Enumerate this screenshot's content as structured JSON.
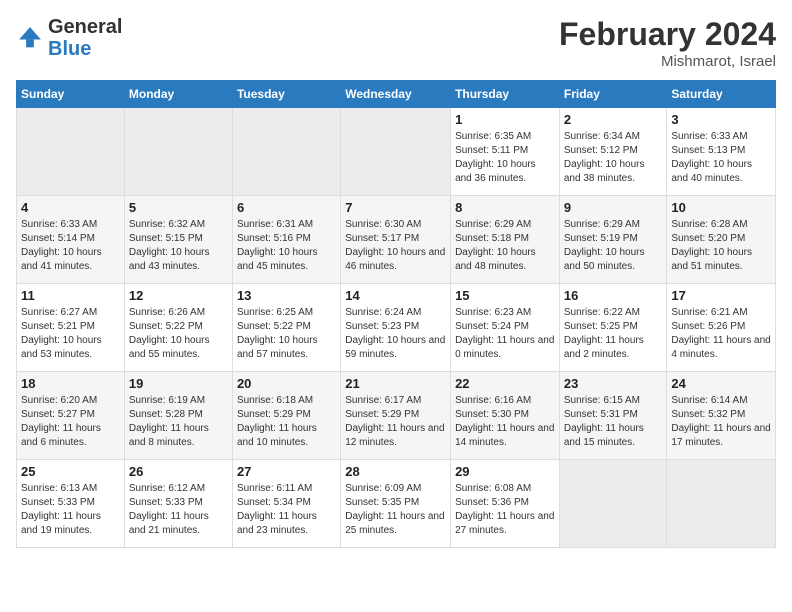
{
  "header": {
    "logo_general": "General",
    "logo_blue": "Blue",
    "month_title": "February 2024",
    "location": "Mishmarot, Israel"
  },
  "days_of_week": [
    "Sunday",
    "Monday",
    "Tuesday",
    "Wednesday",
    "Thursday",
    "Friday",
    "Saturday"
  ],
  "weeks": [
    [
      {
        "day": "",
        "empty": true
      },
      {
        "day": "",
        "empty": true
      },
      {
        "day": "",
        "empty": true
      },
      {
        "day": "",
        "empty": true
      },
      {
        "day": "1",
        "sunrise": "6:35 AM",
        "sunset": "5:11 PM",
        "daylight": "10 hours and 36 minutes."
      },
      {
        "day": "2",
        "sunrise": "6:34 AM",
        "sunset": "5:12 PM",
        "daylight": "10 hours and 38 minutes."
      },
      {
        "day": "3",
        "sunrise": "6:33 AM",
        "sunset": "5:13 PM",
        "daylight": "10 hours and 40 minutes."
      }
    ],
    [
      {
        "day": "4",
        "sunrise": "6:33 AM",
        "sunset": "5:14 PM",
        "daylight": "10 hours and 41 minutes."
      },
      {
        "day": "5",
        "sunrise": "6:32 AM",
        "sunset": "5:15 PM",
        "daylight": "10 hours and 43 minutes."
      },
      {
        "day": "6",
        "sunrise": "6:31 AM",
        "sunset": "5:16 PM",
        "daylight": "10 hours and 45 minutes."
      },
      {
        "day": "7",
        "sunrise": "6:30 AM",
        "sunset": "5:17 PM",
        "daylight": "10 hours and 46 minutes."
      },
      {
        "day": "8",
        "sunrise": "6:29 AM",
        "sunset": "5:18 PM",
        "daylight": "10 hours and 48 minutes."
      },
      {
        "day": "9",
        "sunrise": "6:29 AM",
        "sunset": "5:19 PM",
        "daylight": "10 hours and 50 minutes."
      },
      {
        "day": "10",
        "sunrise": "6:28 AM",
        "sunset": "5:20 PM",
        "daylight": "10 hours and 51 minutes."
      }
    ],
    [
      {
        "day": "11",
        "sunrise": "6:27 AM",
        "sunset": "5:21 PM",
        "daylight": "10 hours and 53 minutes."
      },
      {
        "day": "12",
        "sunrise": "6:26 AM",
        "sunset": "5:22 PM",
        "daylight": "10 hours and 55 minutes."
      },
      {
        "day": "13",
        "sunrise": "6:25 AM",
        "sunset": "5:22 PM",
        "daylight": "10 hours and 57 minutes."
      },
      {
        "day": "14",
        "sunrise": "6:24 AM",
        "sunset": "5:23 PM",
        "daylight": "10 hours and 59 minutes."
      },
      {
        "day": "15",
        "sunrise": "6:23 AM",
        "sunset": "5:24 PM",
        "daylight": "11 hours and 0 minutes."
      },
      {
        "day": "16",
        "sunrise": "6:22 AM",
        "sunset": "5:25 PM",
        "daylight": "11 hours and 2 minutes."
      },
      {
        "day": "17",
        "sunrise": "6:21 AM",
        "sunset": "5:26 PM",
        "daylight": "11 hours and 4 minutes."
      }
    ],
    [
      {
        "day": "18",
        "sunrise": "6:20 AM",
        "sunset": "5:27 PM",
        "daylight": "11 hours and 6 minutes."
      },
      {
        "day": "19",
        "sunrise": "6:19 AM",
        "sunset": "5:28 PM",
        "daylight": "11 hours and 8 minutes."
      },
      {
        "day": "20",
        "sunrise": "6:18 AM",
        "sunset": "5:29 PM",
        "daylight": "11 hours and 10 minutes."
      },
      {
        "day": "21",
        "sunrise": "6:17 AM",
        "sunset": "5:29 PM",
        "daylight": "11 hours and 12 minutes."
      },
      {
        "day": "22",
        "sunrise": "6:16 AM",
        "sunset": "5:30 PM",
        "daylight": "11 hours and 14 minutes."
      },
      {
        "day": "23",
        "sunrise": "6:15 AM",
        "sunset": "5:31 PM",
        "daylight": "11 hours and 15 minutes."
      },
      {
        "day": "24",
        "sunrise": "6:14 AM",
        "sunset": "5:32 PM",
        "daylight": "11 hours and 17 minutes."
      }
    ],
    [
      {
        "day": "25",
        "sunrise": "6:13 AM",
        "sunset": "5:33 PM",
        "daylight": "11 hours and 19 minutes."
      },
      {
        "day": "26",
        "sunrise": "6:12 AM",
        "sunset": "5:33 PM",
        "daylight": "11 hours and 21 minutes."
      },
      {
        "day": "27",
        "sunrise": "6:11 AM",
        "sunset": "5:34 PM",
        "daylight": "11 hours and 23 minutes."
      },
      {
        "day": "28",
        "sunrise": "6:09 AM",
        "sunset": "5:35 PM",
        "daylight": "11 hours and 25 minutes."
      },
      {
        "day": "29",
        "sunrise": "6:08 AM",
        "sunset": "5:36 PM",
        "daylight": "11 hours and 27 minutes."
      },
      {
        "day": "",
        "empty": true
      },
      {
        "day": "",
        "empty": true
      }
    ]
  ],
  "labels": {
    "sunrise_prefix": "Sunrise: ",
    "sunset_prefix": "Sunset: ",
    "daylight_prefix": "Daylight: "
  }
}
